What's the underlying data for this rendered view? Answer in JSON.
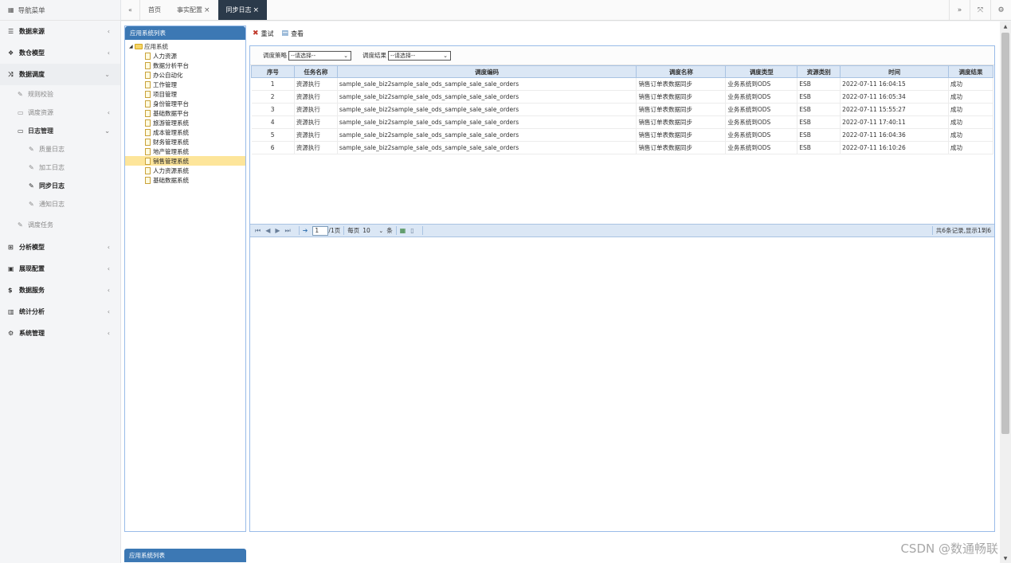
{
  "sidebar": {
    "title": "导航菜单",
    "items": {
      "data_source": "数据来源",
      "warehouse_model": "数仓模型",
      "data_schedule": "数据调度",
      "rule_check": "规则校验",
      "schedule_resource": "调度资源",
      "log_manage": "日志管理",
      "quality_log": "质量日志",
      "process_log": "加工日志",
      "sync_log": "同步日志",
      "notify_log": "通知日志",
      "schedule_task": "调度任务",
      "analysis_model": "分析模型",
      "display_config": "展现配置",
      "data_service": "数据服务",
      "stat_analysis": "统计分析",
      "system_manage": "系统管理"
    }
  },
  "tabs": {
    "home": "首页",
    "fact_config": "事实配置",
    "sync_log": "同步日志",
    "close_glyph": "×"
  },
  "tree_panel": {
    "title": "应用系统列表",
    "root": "应用系统",
    "leaves": [
      "人力资源",
      "数据分析平台",
      "办公自动化",
      "工作管理",
      "项目管理",
      "身份管理平台",
      "基础数据平台",
      "旅游管理系统",
      "成本管理系统",
      "财务管理系统",
      "地产管理系统",
      "销售管理系统",
      "人力资源系统",
      "基础数据系统"
    ],
    "selected_index": 11
  },
  "tree_panel_2": {
    "title": "应用系统列表"
  },
  "toolbar": {
    "retry": "重试",
    "view": "查看"
  },
  "filters": {
    "strategy_label": "调度策略",
    "strategy_value": "--请选择--",
    "result_label": "调度结果",
    "result_value": "--请选择--"
  },
  "grid": {
    "headers": [
      "序号",
      "任务名称",
      "调度编码",
      "调度名称",
      "调度类型",
      "资源类别",
      "时间",
      "调度结果"
    ],
    "rows": [
      [
        "1",
        "资源执行",
        "sample_sale_biz2sample_sale_ods_sample_sale_sale_orders",
        "销售订单表数据同步",
        "业务系统到ODS",
        "ESB",
        "2022-07-11 16:04:15",
        "成功"
      ],
      [
        "2",
        "资源执行",
        "sample_sale_biz2sample_sale_ods_sample_sale_sale_orders",
        "销售订单表数据同步",
        "业务系统到ODS",
        "ESB",
        "2022-07-11 16:05:34",
        "成功"
      ],
      [
        "3",
        "资源执行",
        "sample_sale_biz2sample_sale_ods_sample_sale_sale_orders",
        "销售订单表数据同步",
        "业务系统到ODS",
        "ESB",
        "2022-07-11 15:55:27",
        "成功"
      ],
      [
        "4",
        "资源执行",
        "sample_sale_biz2sample_sale_ods_sample_sale_sale_orders",
        "销售订单表数据同步",
        "业务系统到ODS",
        "ESB",
        "2022-07-11 17:40:11",
        "成功"
      ],
      [
        "5",
        "资源执行",
        "sample_sale_biz2sample_sale_ods_sample_sale_sale_orders",
        "销售订单表数据同步",
        "业务系统到ODS",
        "ESB",
        "2022-07-11 16:04:36",
        "成功"
      ],
      [
        "6",
        "资源执行",
        "sample_sale_biz2sample_sale_ods_sample_sale_sale_orders",
        "销售订单表数据同步",
        "业务系统到ODS",
        "ESB",
        "2022-07-11 16:10:26",
        "成功"
      ]
    ]
  },
  "pager": {
    "current_page": "1",
    "total_pages": "/1页",
    "per_page_label": "每页",
    "per_page_value": "10",
    "per_page_unit": "条",
    "summary": "共6条记录,显示1到6"
  },
  "watermark": "CSDN @数通畅联",
  "colors": {
    "panel_header": "#3c78b4",
    "active_tab": "#2b3a4a",
    "grid_header": "#dbe7f5",
    "tree_selected": "#fde59a"
  }
}
